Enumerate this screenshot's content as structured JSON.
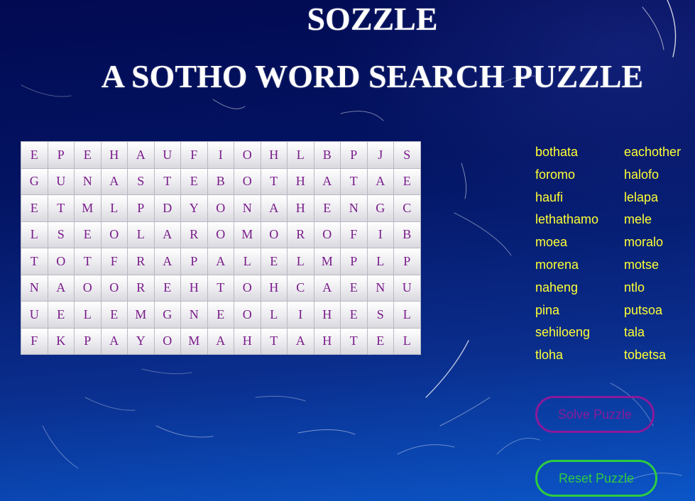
{
  "header": {
    "title": "SOZZLE",
    "subtitle": "A SOTHO WORD SEARCH PUZZLE"
  },
  "grid": {
    "rows": [
      [
        "E",
        "P",
        "E",
        "H",
        "A",
        "U",
        "F",
        "I",
        "O",
        "H",
        "L",
        "B",
        "P",
        "J",
        "S"
      ],
      [
        "G",
        "U",
        "N",
        "A",
        "S",
        "T",
        "E",
        "B",
        "O",
        "T",
        "H",
        "A",
        "T",
        "A",
        "E"
      ],
      [
        "E",
        "T",
        "M",
        "L",
        "P",
        "D",
        "Y",
        "O",
        "N",
        "A",
        "H",
        "E",
        "N",
        "G",
        "C"
      ],
      [
        "L",
        "S",
        "E",
        "O",
        "L",
        "A",
        "R",
        "O",
        "M",
        "O",
        "R",
        "O",
        "F",
        "I",
        "B"
      ],
      [
        "T",
        "O",
        "T",
        "F",
        "R",
        "A",
        "P",
        "A",
        "L",
        "E",
        "L",
        "M",
        "P",
        "L",
        "P"
      ],
      [
        "N",
        "A",
        "O",
        "O",
        "R",
        "E",
        "H",
        "T",
        "O",
        "H",
        "C",
        "A",
        "E",
        "N",
        "U"
      ],
      [
        "U",
        "E",
        "L",
        "E",
        "M",
        "G",
        "N",
        "E",
        "O",
        "L",
        "I",
        "H",
        "E",
        "S",
        "L"
      ],
      [
        "F",
        "K",
        "P",
        "A",
        "Y",
        "O",
        "M",
        "A",
        "H",
        "T",
        "A",
        "H",
        "T",
        "E",
        "L"
      ]
    ]
  },
  "word_list": {
    "words": [
      "bothata",
      "eachother",
      "foromo",
      "halofo",
      "haufi",
      "lelapa",
      "lethathamo",
      "mele",
      "moea",
      "moralo",
      "morena",
      "motse",
      "naheng",
      "ntlo",
      "pina",
      "putsoa",
      "sehiloeng",
      "tala",
      "tloha",
      "tobetsa"
    ]
  },
  "buttons": {
    "solve_label": "Solve Puzzle",
    "reset_label": "Reset Puzzle"
  },
  "colors": {
    "word_list_text": "#ffff33",
    "grid_letter": "#7a1a8a",
    "solve_button": "#8a1a9a",
    "reset_button": "#2ecc40"
  }
}
